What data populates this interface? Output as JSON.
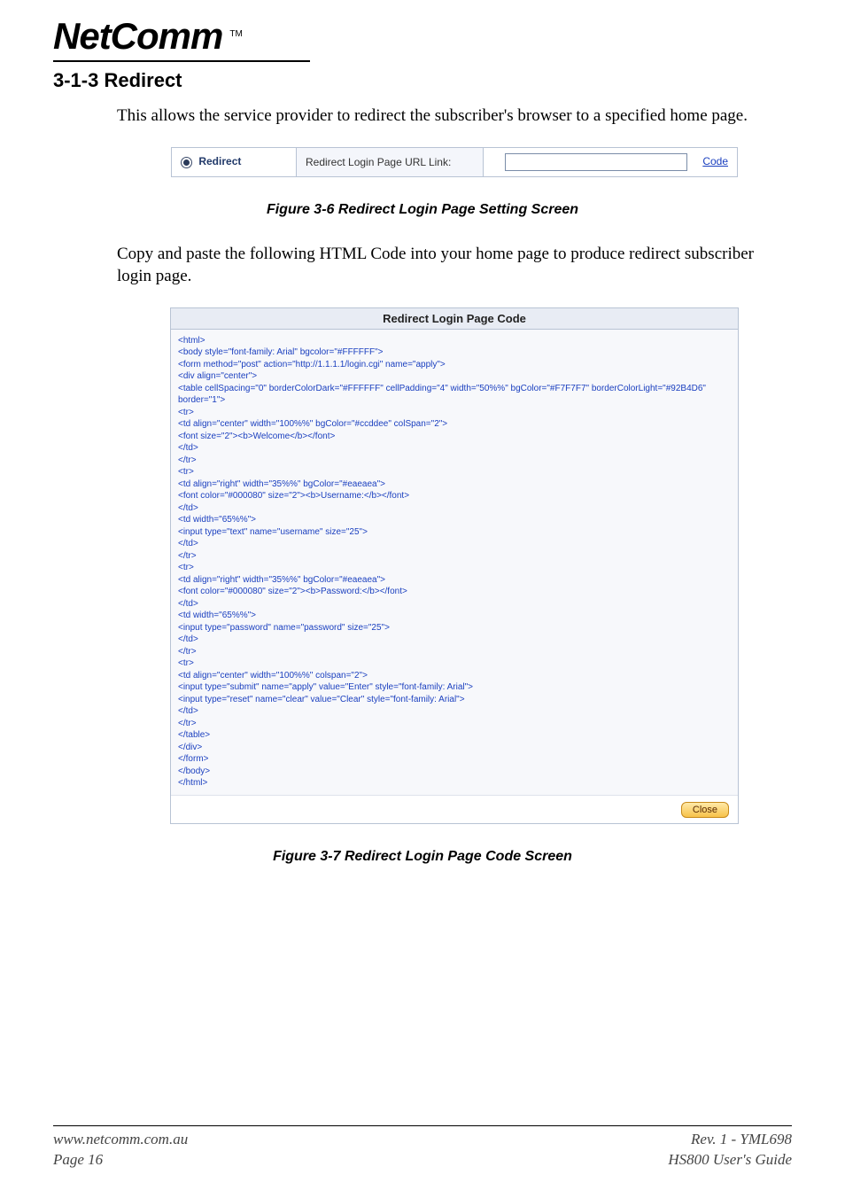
{
  "logo": {
    "text": "NetComm",
    "tm": "TM"
  },
  "heading": "3-1-3  Redirect",
  "para1": "This allows the service provider to redirect the subscriber's browser to a specified home page.",
  "ui1": {
    "radio_label": "Redirect",
    "field_label": "Redirect Login Page URL Link:",
    "input_value": "",
    "code_link": "Code"
  },
  "caption1": "Figure 3-6 Redirect Login Page Setting Screen",
  "para2": "Copy and paste the following HTML Code into your home page to produce redirect subscriber login page.",
  "code_panel": {
    "title": "Redirect Login Page Code",
    "code": "<html>\n<body style=\"font-family: Arial\" bgcolor=\"#FFFFFF\">\n<form method=\"post\" action=\"http://1.1.1.1/login.cgi\" name=\"apply\">\n<div align=\"center\">\n<table cellSpacing=\"0\" borderColorDark=\"#FFFFFF\" cellPadding=\"4\" width=\"50%%\" bgColor=\"#F7F7F7\" borderColorLight=\"#92B4D6\" border=\"1\">\n<tr>\n<td align=\"center\" width=\"100%%\" bgColor=\"#ccddee\" colSpan=\"2\">\n<font size=\"2\"><b>Welcome</b></font>\n</td>\n</tr>\n<tr>\n<td align=\"right\" width=\"35%%\" bgColor=\"#eaeaea\">\n<font color=\"#000080\" size=\"2\"><b>Username:</b></font>\n</td>\n<td width=\"65%%\">\n<input type=\"text\" name=\"username\" size=\"25\">\n</td>\n</tr>\n<tr>\n<td align=\"right\" width=\"35%%\" bgColor=\"#eaeaea\">\n<font color=\"#000080\" size=\"2\"><b>Password:</b></font>\n</td>\n<td width=\"65%%\">\n<input type=\"password\" name=\"password\" size=\"25\">\n</td>\n</tr>\n<tr>\n<td align=\"center\" width=\"100%%\" colspan=\"2\">\n<input type=\"submit\" name=\"apply\" value=\"Enter\" style=\"font-family: Arial\">\n<input type=\"reset\" name=\"clear\" value=\"Clear\" style=\"font-family: Arial\">\n</td>\n</tr>\n</table>\n</div>\n</form>\n</body>\n</html>",
    "close": "Close"
  },
  "caption2": "Figure 3-7 Redirect Login Page Code Screen",
  "footer": {
    "url": "www.netcomm.com.au",
    "page": "Page 16",
    "rev": "Rev. 1 - YML698",
    "guide": "HS800 User's Guide"
  }
}
